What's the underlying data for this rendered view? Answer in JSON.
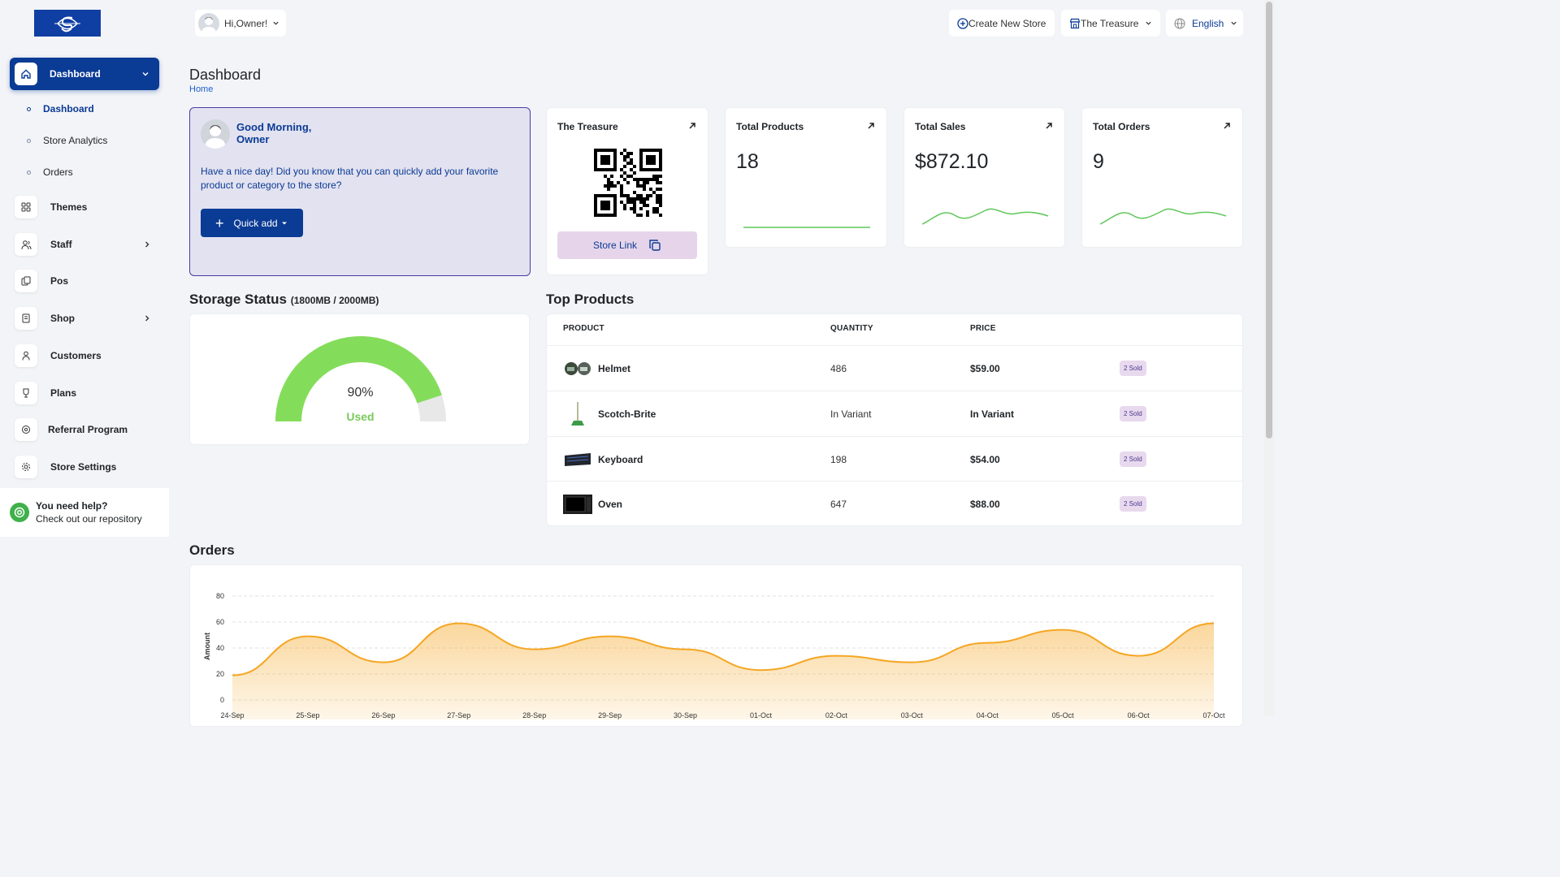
{
  "sidebar": {
    "active": {
      "label": "Dashboard"
    },
    "sub_items": [
      {
        "label": "Dashboard"
      },
      {
        "label": "Store Analytics"
      },
      {
        "label": "Orders"
      }
    ],
    "items": [
      {
        "label": "Themes"
      },
      {
        "label": "Staff"
      },
      {
        "label": "Pos"
      },
      {
        "label": "Shop"
      },
      {
        "label": "Customers"
      },
      {
        "label": "Plans"
      },
      {
        "label": "Referral Program"
      },
      {
        "label": "Store Settings"
      }
    ],
    "help": {
      "title": "You need help?",
      "subtitle": "Check out our repository"
    }
  },
  "topbar": {
    "user_greeting": "Hi,Owner!",
    "create_store": "Create New Store",
    "store_select": "The Treasure",
    "language": "English"
  },
  "header": {
    "title": "Dashboard",
    "breadcrumb": "Home"
  },
  "welcome": {
    "greeting_line1": "Good Morning,",
    "greeting_line2": "Owner",
    "message": "Have a nice day! Did you know that you can quickly add your favorite product or category to the store?",
    "quick_add": "Quick add"
  },
  "store_card": {
    "title": "The Treasure",
    "link_label": "Store Link"
  },
  "stats": [
    {
      "title": "Total Products",
      "value": "18"
    },
    {
      "title": "Total Sales",
      "value": "$872.10"
    },
    {
      "title": "Total Orders",
      "value": "9"
    }
  ],
  "storage": {
    "title": "Storage Status",
    "detail": "(1800MB / 2000MB)",
    "percent_label": "90%",
    "used_label": "Used",
    "fraction": 0.9,
    "color": "#84dd5a"
  },
  "top_products": {
    "title": "Top Products",
    "columns": [
      "PRODUCT",
      "QUANTITY",
      "PRICE"
    ],
    "rows": [
      {
        "name": "Helmet",
        "quantity": "486",
        "price": "$59.00",
        "badge": "2 Sold"
      },
      {
        "name": "Scotch-Brite",
        "quantity": "In Variant",
        "price": "In Variant",
        "badge": "2 Sold"
      },
      {
        "name": "Keyboard",
        "quantity": "198",
        "price": "$54.00",
        "badge": "2 Sold"
      },
      {
        "name": "Oven",
        "quantity": "647",
        "price": "$88.00",
        "badge": "2 Sold"
      }
    ]
  },
  "orders_title": "Orders",
  "chart_data": {
    "type": "area",
    "ylabel": "Amount",
    "ylim": [
      0,
      80
    ],
    "yticks": [
      "0",
      "20",
      "40",
      "60",
      "80"
    ],
    "x": [
      "24-Sep",
      "25-Sep",
      "26-Sep",
      "27-Sep",
      "28-Sep",
      "29-Sep",
      "30-Sep",
      "01-Oct",
      "02-Oct",
      "03-Oct",
      "04-Oct",
      "05-Oct",
      "06-Oct",
      "07-Oct"
    ],
    "series": [
      {
        "values": [
          19,
          49,
          29,
          59,
          39,
          49,
          39,
          23,
          34,
          29,
          44,
          54,
          34,
          59
        ]
      }
    ],
    "grid": true,
    "color": "#f5a623"
  }
}
